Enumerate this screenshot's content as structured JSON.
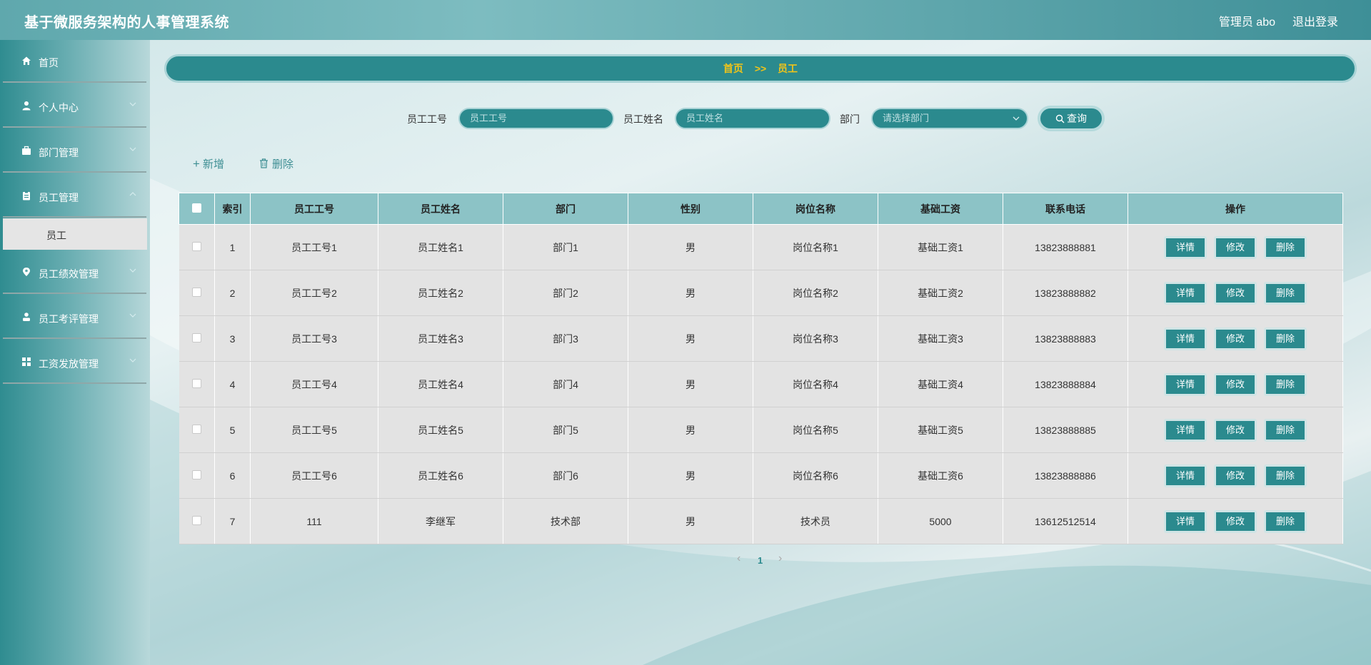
{
  "header": {
    "title": "基于微服务架构的人事管理系统",
    "user": "管理员 abo",
    "logout": "退出登录"
  },
  "sidebar": {
    "items": [
      {
        "label": "首页",
        "icon": "home-icon"
      },
      {
        "label": "个人中心",
        "icon": "user-icon"
      },
      {
        "label": "部门管理",
        "icon": "briefcase-icon"
      },
      {
        "label": "员工管理",
        "icon": "clipboard-icon"
      },
      {
        "label": "员工绩效管理",
        "icon": "location-pin-icon"
      },
      {
        "label": "员工考评管理",
        "icon": "person-icon"
      },
      {
        "label": "工资发放管理",
        "icon": "grid-icon"
      }
    ],
    "sub_item": "员工"
  },
  "breadcrumb": {
    "home": "首页",
    "sep": ">>",
    "current": "员工"
  },
  "search": {
    "id_label": "员工工号",
    "id_placeholder": "员工工号",
    "name_label": "员工姓名",
    "name_placeholder": "员工姓名",
    "dept_label": "部门",
    "dept_placeholder": "请选择部门",
    "query": "查询"
  },
  "actions": {
    "add": "新增",
    "delete": "删除"
  },
  "table": {
    "headers": [
      "索引",
      "员工工号",
      "员工姓名",
      "部门",
      "性别",
      "岗位名称",
      "基础工资",
      "联系电话",
      "操作"
    ],
    "rows": [
      [
        "1",
        "员工工号1",
        "员工姓名1",
        "部门1",
        "男",
        "岗位名称1",
        "基础工资1",
        "13823888881"
      ],
      [
        "2",
        "员工工号2",
        "员工姓名2",
        "部门2",
        "男",
        "岗位名称2",
        "基础工资2",
        "13823888882"
      ],
      [
        "3",
        "员工工号3",
        "员工姓名3",
        "部门3",
        "男",
        "岗位名称3",
        "基础工资3",
        "13823888883"
      ],
      [
        "4",
        "员工工号4",
        "员工姓名4",
        "部门4",
        "男",
        "岗位名称4",
        "基础工资4",
        "13823888884"
      ],
      [
        "5",
        "员工工号5",
        "员工姓名5",
        "部门5",
        "男",
        "岗位名称5",
        "基础工资5",
        "13823888885"
      ],
      [
        "6",
        "员工工号6",
        "员工姓名6",
        "部门6",
        "男",
        "岗位名称6",
        "基础工资6",
        "13823888886"
      ],
      [
        "7",
        "111",
        "李继军",
        "技术部",
        "男",
        "技术员",
        "5000",
        "13612512514"
      ]
    ],
    "ops": [
      "详情",
      "修改",
      "删除"
    ]
  },
  "pager": {
    "prev": "‹",
    "page": "1",
    "next": "›"
  },
  "colors": {
    "primary": "#2b8a8e",
    "breadcrumb_text": "#f0c419",
    "header_bg": "#5fa8ad"
  }
}
